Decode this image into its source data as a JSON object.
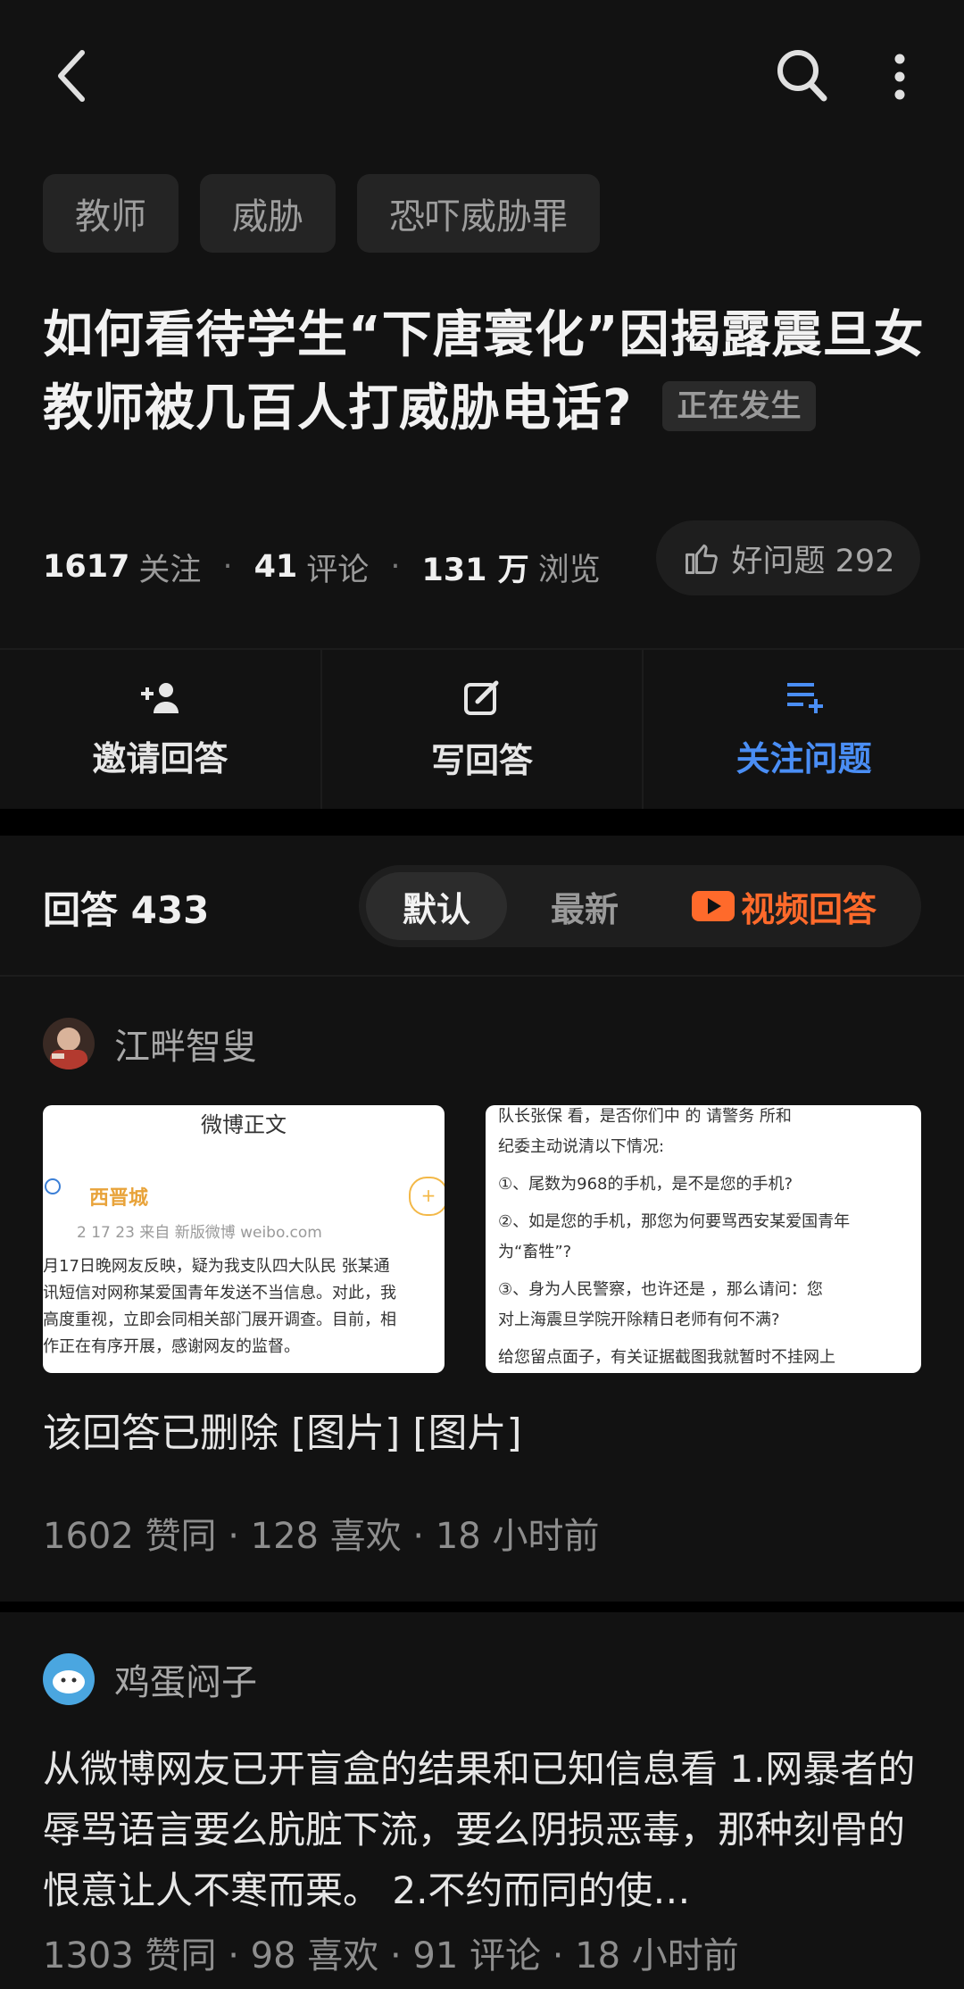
{
  "topbar": {
    "back_icon": "chevron-left-icon",
    "search_icon": "search-icon",
    "more_icon": "more-vertical-icon"
  },
  "tags": [
    "教师",
    "威胁",
    "恐吓威胁罪"
  ],
  "question": {
    "title": "如何看待学生“下唐寰化”因揭露震旦女教师被几百人打威胁电话?",
    "badge": "正在发生",
    "follow_count": "1617",
    "follow_label": "关注",
    "comment_count": "41",
    "comment_label": "评论",
    "view_count": "131 万",
    "view_label": "浏览",
    "good_label": "好问题 292"
  },
  "actions": [
    {
      "label": "邀请回答",
      "icon": "add-person-icon"
    },
    {
      "label": "写回答",
      "icon": "edit-icon"
    },
    {
      "label": "关注问题",
      "icon": "add-list-icon"
    }
  ],
  "answers_header": {
    "count_label": "回答 433",
    "sort_default": "默认",
    "sort_latest": "最新",
    "video_label": "视频回答"
  },
  "answers": [
    {
      "author": "江畔智叟",
      "text": "该回答已删除 [图片] [图片]",
      "meta": "1602 赞同 · 128 喜欢 · 18 小时前",
      "img1": {
        "header": "微博正文",
        "name": "西晋城",
        "time": "2   17 23  来自 新版微博 weibo.com",
        "lines": [
          "月17日晚网友反映，疑为我支队四大队民 张某通",
          "讯短信对网称某爱国青年发送不当信息。对此，我",
          "高度重视，立即会同相关部门展开调查。目前，相",
          "作正在有序开展，感谢网友的监督。"
        ]
      },
      "img2": {
        "lines": [
          "队长张保 看，是否你们中  的 请警务  所和",
          "纪委主动说清以下情况:",
          "①、尾数为968的手机，是不是您的手机?",
          "②、如是您的手机，那您为何要骂西安某爱国青年",
          "为“畜牲”?",
          "③、身为人民警察，也许还是  ，那么请问：您",
          "对上海震旦学院开除精日老师有何不满?",
          "给您留点面子，有关证据截图我就暂时不挂网上"
        ]
      }
    },
    {
      "author": "鸡蛋闷子",
      "text": "从微博网友已开盲盒的结果和已知信息看 1.网暴者的辱骂语言要么肮脏下流，要么阴损恶毒，那种刻骨的恨意让人不寒而栗。 2.不约而同的使…",
      "meta": "1303 赞同 · 98 喜欢 · 91 评论 · 18 小时前"
    }
  ],
  "colors": {
    "background": "#121212",
    "accent_blue": "#4a8ef5",
    "video_orange": "#ff6a2b"
  }
}
